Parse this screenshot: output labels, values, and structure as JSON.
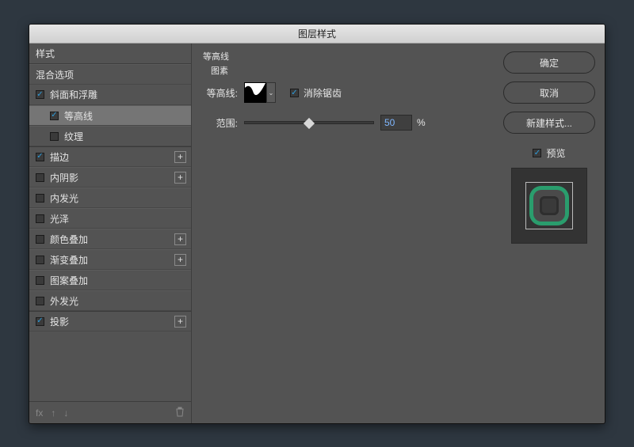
{
  "title": "图层样式",
  "left": {
    "styles": "样式",
    "blend": "混合选项",
    "items": [
      {
        "key": "bevel",
        "label": "斜面和浮雕",
        "checked": true,
        "plus": false
      },
      {
        "key": "contour",
        "label": "等高线",
        "checked": true,
        "plus": false,
        "sub": true,
        "selected": true
      },
      {
        "key": "texture",
        "label": "纹理",
        "checked": false,
        "plus": false,
        "sub": true
      },
      {
        "key": "stroke",
        "label": "描边",
        "checked": true,
        "plus": true,
        "gap": true
      },
      {
        "key": "innerShadow",
        "label": "内阴影",
        "checked": false,
        "plus": true
      },
      {
        "key": "innerGlow",
        "label": "内发光",
        "checked": false,
        "plus": false
      },
      {
        "key": "satin",
        "label": "光泽",
        "checked": false,
        "plus": false
      },
      {
        "key": "colorOverlay",
        "label": "颜色叠加",
        "checked": false,
        "plus": true
      },
      {
        "key": "gradOverlay",
        "label": "渐变叠加",
        "checked": false,
        "plus": true
      },
      {
        "key": "patternOverlay",
        "label": "图案叠加",
        "checked": false,
        "plus": false
      },
      {
        "key": "outerGlow",
        "label": "外发光",
        "checked": false,
        "plus": false
      },
      {
        "key": "dropShadow",
        "label": "投影",
        "checked": true,
        "plus": true,
        "gap": true
      }
    ],
    "footer": {
      "fx": "fx",
      "up": "▲",
      "down": "▼",
      "trash": "🗑"
    }
  },
  "middle": {
    "section": "等高线",
    "sub": "图素",
    "contourLabel": "等高线:",
    "antiAlias": {
      "label": "消除锯齿",
      "checked": true
    },
    "rangeLabel": "范围:",
    "rangeValue": "50",
    "pct": "%"
  },
  "right": {
    "ok": "确定",
    "cancel": "取消",
    "newStyle": "新建样式...",
    "preview": {
      "label": "预览",
      "checked": true
    }
  }
}
